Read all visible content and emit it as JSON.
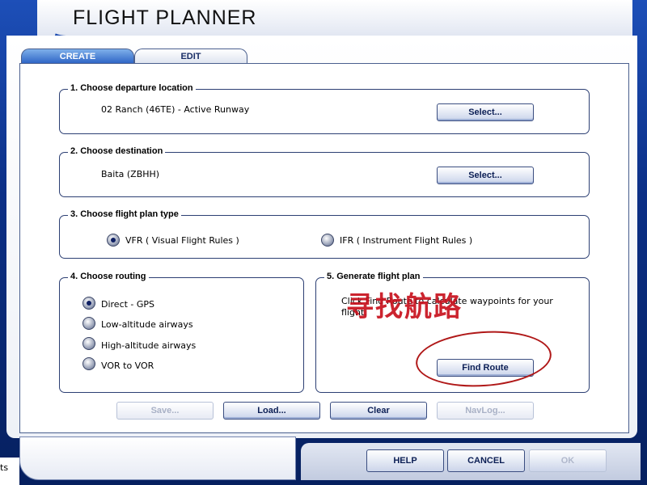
{
  "window": {
    "title": "FLIGHT PLANNER"
  },
  "tabs": [
    {
      "label": "CREATE",
      "active": true
    },
    {
      "label": "EDIT",
      "active": false
    }
  ],
  "departure": {
    "legend": "1. Choose departure location",
    "value": "02 Ranch (46TE) - Active Runway",
    "select_label": "Select..."
  },
  "destination": {
    "legend": "2. Choose destination",
    "value": "Baita (ZBHH)",
    "select_label": "Select..."
  },
  "plan_type": {
    "legend": "3. Choose flight plan type",
    "options": [
      {
        "label": "VFR   ( Visual Flight Rules )",
        "selected": true
      },
      {
        "label": "IFR   ( Instrument Flight Rules )",
        "selected": false
      }
    ]
  },
  "routing": {
    "legend": "4. Choose routing",
    "options": [
      {
        "label": "Direct - GPS",
        "selected": true
      },
      {
        "label": "Low-altitude airways",
        "selected": false
      },
      {
        "label": "High-altitude airways",
        "selected": false
      },
      {
        "label": "VOR to VOR",
        "selected": false
      }
    ]
  },
  "generate": {
    "legend": "5. Generate flight plan",
    "hint_line1": "Click Find Route to calculate waypoints for your",
    "hint_line2": "flight.",
    "find_route_label": "Find Route",
    "annotation_text": "寻找航路"
  },
  "actions": {
    "save": "Save...",
    "load": "Load...",
    "clear": "Clear",
    "navlog": "NavLog..."
  },
  "footer": {
    "side_text": "ts",
    "help": "HELP",
    "cancel": "CANCEL",
    "ok": "OK"
  },
  "colors": {
    "annotation": "#c8121e",
    "frame": "#0b2f86",
    "active_tab": "#2b62c4"
  }
}
